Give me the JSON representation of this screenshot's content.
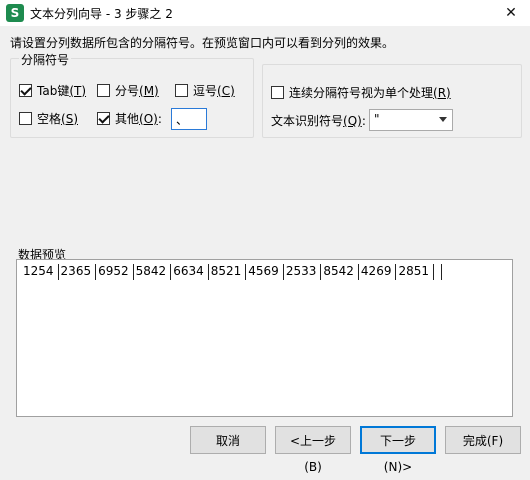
{
  "window": {
    "app_icon": "S",
    "title": "文本分列向导 - 3 步骤之 2",
    "close": "✕"
  },
  "instruction": "请设置分列数据所包含的分隔符号。在预览窗口内可以看到分列的效果。",
  "delimiters": {
    "legend": "分隔符号",
    "tab": {
      "label": "Tab键",
      "key": "(T)",
      "checked": true
    },
    "semicolon": {
      "label": "分号",
      "key": "(M)",
      "checked": false
    },
    "comma": {
      "label": "逗号",
      "key": "(C)",
      "checked": false
    },
    "space": {
      "label": "空格",
      "key": "(S)",
      "checked": false
    },
    "other": {
      "label": "其他",
      "key": "(O)",
      "colon": ":",
      "checked": true,
      "value": "、"
    }
  },
  "options": {
    "consecutive": {
      "label": "连续分隔符号视为单个处理",
      "key": "(R)",
      "checked": false
    },
    "qualifier": {
      "label": "文本识别符号",
      "key": "(Q)",
      "colon": ":",
      "value": "\""
    }
  },
  "preview": {
    "label": "数据预览",
    "cells": [
      "1254",
      "2365",
      "6952",
      "5842",
      "6634",
      "8521",
      "4569",
      "2533",
      "8542",
      "4269",
      "2851",
      ""
    ]
  },
  "buttons": {
    "cancel": "取消",
    "back": "<上一步(B)",
    "next": "下一步(N)>",
    "finish": "完成(F)"
  },
  "colors": {
    "accent": "#0078d7",
    "app_icon": "#1e8b4f"
  }
}
